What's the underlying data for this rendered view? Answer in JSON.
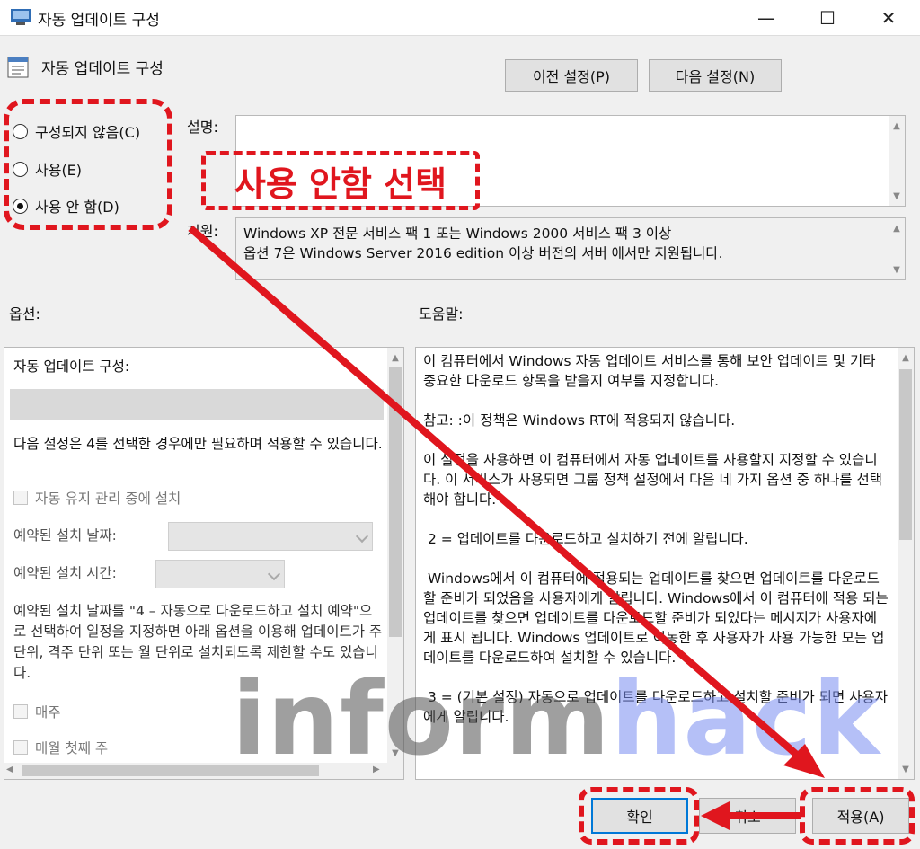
{
  "window": {
    "title": "자동 업데이트 구성",
    "minimize": "—",
    "maximize": "☐",
    "close": "✕"
  },
  "policy": {
    "title": "자동 업데이트 구성",
    "prev_button": "이전 설정(P)",
    "next_button": "다음 설정(N)"
  },
  "state": {
    "not_configured": "구성되지 않음(C)",
    "enabled": "사용(E)",
    "disabled": "사용 안 함(D)",
    "selected": "disabled"
  },
  "labels": {
    "comment": "설명:",
    "supported": "지원:",
    "options": "옵션:",
    "help": "도움말:"
  },
  "supported_text": "Windows XP 전문 서비스 팩 1 또는 Windows 2000 서비스 팩 3 이상\n옵션 7은 Windows Server 2016 edition 이상 버전의 서버 에서만 지원됩니다.",
  "options": {
    "heading": "자동 업데이트 구성:",
    "note": "다음 설정은 4를 선택한 경우에만 필요하며 적용할 수 있습니다.",
    "install_during_maintenance": "자동 유지 관리 중에 설치",
    "scheduled_day_label": "예약된 설치 날짜:",
    "scheduled_time_label": "예약된 설치 시간:",
    "schedule_note": "예약된 설치 날짜를 \"4 – 자동으로 다운로드하고 설치 예약\"으로 선택하여 일정을 지정하면 아래 옵션을 이용해 업데이트가 주 단위, 격주 단위 또는 월 단위로 설치되도록 제한할 수도 있습니다.",
    "every_week": "매주",
    "first_week": "매월 첫째 주"
  },
  "help_text": "이 컴퓨터에서 Windows 자동 업데이트 서비스를 통해 보안 업데이트 및 기타 중요한 다운로드 항목을 받을지 여부를 지정합니다.\n\n참고: :이 정책은 Windows RT에 적용되지 않습니다.\n\n이 설정을 사용하면 이 컴퓨터에서 자동 업데이트를 사용할지 지정할 수 있습니다. 이 서비스가 사용되면 그룹 정책 설정에서 다음 네 가지 옵션 중 하나를 선택해야 합니다.\n\n 2 = 업데이트를 다운로드하고 설치하기 전에 알립니다.\n\n Windows에서 이 컴퓨터에 적용되는 업데이트를 찾으면 업데이트를 다운로드할 준비가 되었음을 사용자에게 알립니다. Windows에서 이 컴퓨터에 적용 되는 업데이트를 찾으면 업데이트를 다운로드할 준비가 되었다는 메시지가 사용자에 게 표시 됩니다. Windows 업데이트로 이동한 후 사용자가 사용 가능한 모든 업데이트를 다운로드하여 설치할 수 있습니다.\n\n 3 = (기본 설정) 자동으로 업데이트를 다운로드하고 설치할 준비가 되면 사용자에게 알립니다.",
  "buttons": {
    "ok": "확인",
    "cancel": "취소",
    "apply": "적용(A)"
  },
  "annotation": {
    "callout": "사용 안함 선택",
    "color": "#e0161e"
  },
  "watermark": {
    "part1": "inform",
    "part2": "hack"
  }
}
